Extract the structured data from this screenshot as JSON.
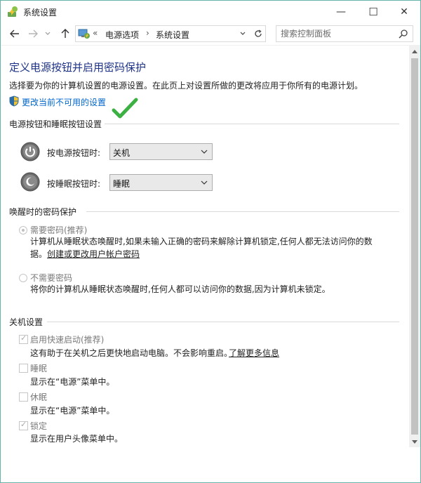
{
  "window": {
    "title": "系统设置",
    "controls": {
      "minimize": "—",
      "maximize": "☐",
      "close": "✕"
    }
  },
  "address_bar": {
    "prefix": "«",
    "crumbs": [
      "电源选项",
      "系统设置"
    ],
    "separator": "›",
    "search_placeholder": "搜索控制面板"
  },
  "page": {
    "title": "定义电源按钮并启用密码保护",
    "description": "选择要为你的计算机设置的电源设置。在此页上对设置所做的更改将应用于你所有的电源计划。",
    "change_link": "更改当前不可用的设置"
  },
  "power_section": {
    "header": "电源按钮和睡眠按钮设置",
    "power_button": {
      "label": "按电源按钮时:",
      "value": "关机"
    },
    "sleep_button": {
      "label": "按睡眠按钮时:",
      "value": "睡眠"
    }
  },
  "password_section": {
    "header": "唤醒时的密码保护",
    "require": {
      "title": "需要密码(推荐)",
      "desc_line1": "计算机从睡眠状态唤醒时,如果未输入正确的密码来解除计算机锁定,任何人都无法访问你的数",
      "desc_line2": "据。",
      "link": "创建或更改用户帐户密码",
      "selected": true
    },
    "no_require": {
      "title": "不需要密码",
      "desc": "将你的计算机从睡眠状态唤醒时,任何人都可以访问你的数据,因为计算机未锁定。",
      "selected": false
    }
  },
  "shutdown_section": {
    "header": "关机设置",
    "fast_startup": {
      "title": "启用快速启动(推荐)",
      "desc": "这有助于在关机之后更快地启动电脑。不会影响重启。",
      "link": "了解更多信息",
      "checked": true
    },
    "sleep": {
      "title": "睡眠",
      "desc": "显示在“电源”菜单中。",
      "checked": false
    },
    "hibernate": {
      "title": "休眠",
      "desc": "显示在“电源”菜单中。",
      "checked": false
    },
    "lock": {
      "title": "锁定",
      "desc": "显示在用户头像菜单中。",
      "checked": true
    }
  },
  "colors": {
    "title_blue": "#1e3287",
    "link_blue": "#0066cc",
    "window_border": "#66b3a9",
    "check_green": "#3cb043"
  }
}
